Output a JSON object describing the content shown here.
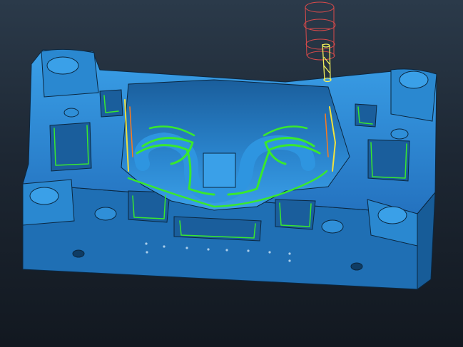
{
  "viewport": {
    "background_top": "#2b3a4a",
    "background_bottom": "#121820"
  },
  "model": {
    "body_color": "#2f8fd8",
    "body_dark": "#1f6fb4",
    "body_shadow": "#17588f",
    "edge_color": "#0b2740"
  },
  "toolpath": {
    "primary_color": "#39e82e",
    "secondary_color": "#f2e23c",
    "tertiary_color": "#ff7a1c"
  },
  "tool": {
    "holder_color": "#d94a4a",
    "cutter_color": "#f1ef5a",
    "icon": "end-mill-cutter-icon"
  }
}
